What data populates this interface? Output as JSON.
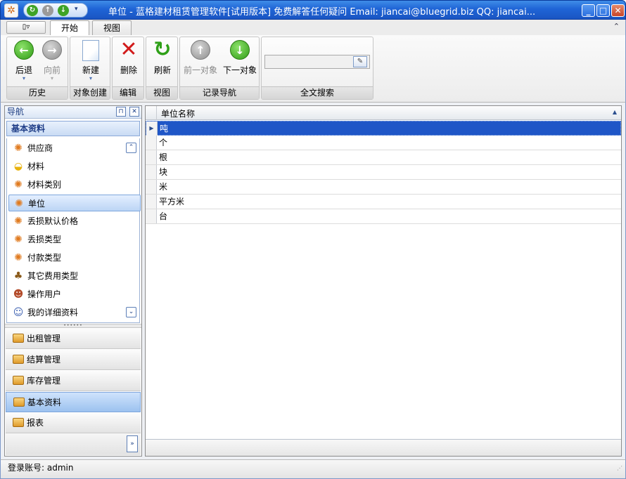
{
  "window": {
    "title": "单位 - 蓝格建材租赁管理软件[试用版本] 免费解答任何疑问 Email: jiancai@bluegrid.biz QQ: jiancai..."
  },
  "ribbon": {
    "tabs": [
      {
        "label": "开始"
      },
      {
        "label": "视图"
      }
    ],
    "groups": {
      "history": {
        "label": "历史",
        "back": "后退",
        "forward": "向前"
      },
      "create": {
        "label": "对象创建",
        "new": "新建"
      },
      "edit": {
        "label": "编辑",
        "delete": "删除"
      },
      "view": {
        "label": "视图",
        "refresh": "刷新"
      },
      "record_nav": {
        "label": "记录导航",
        "prev": "前一对象",
        "next": "下一对象"
      },
      "search": {
        "label": "全文搜索",
        "value": ""
      }
    }
  },
  "nav": {
    "title": "导航",
    "section_title": "基本资料",
    "items": [
      {
        "label": "供应商"
      },
      {
        "label": "材料"
      },
      {
        "label": "材料类别"
      },
      {
        "label": "单位"
      },
      {
        "label": "丢损默认价格"
      },
      {
        "label": "丢损类型"
      },
      {
        "label": "付款类型"
      },
      {
        "label": "其它费用类型"
      },
      {
        "label": "操作用户"
      },
      {
        "label": "我的详细资料"
      }
    ],
    "groups": [
      {
        "label": "出租管理"
      },
      {
        "label": "结算管理"
      },
      {
        "label": "库存管理"
      },
      {
        "label": "基本资料"
      },
      {
        "label": "报表"
      }
    ]
  },
  "grid": {
    "column": "单位名称",
    "rows": [
      {
        "name": "吨"
      },
      {
        "name": "个"
      },
      {
        "name": "根"
      },
      {
        "name": "块"
      },
      {
        "name": "米"
      },
      {
        "name": "平方米"
      },
      {
        "name": "台"
      }
    ]
  },
  "status": {
    "text": "登录账号: admin"
  }
}
